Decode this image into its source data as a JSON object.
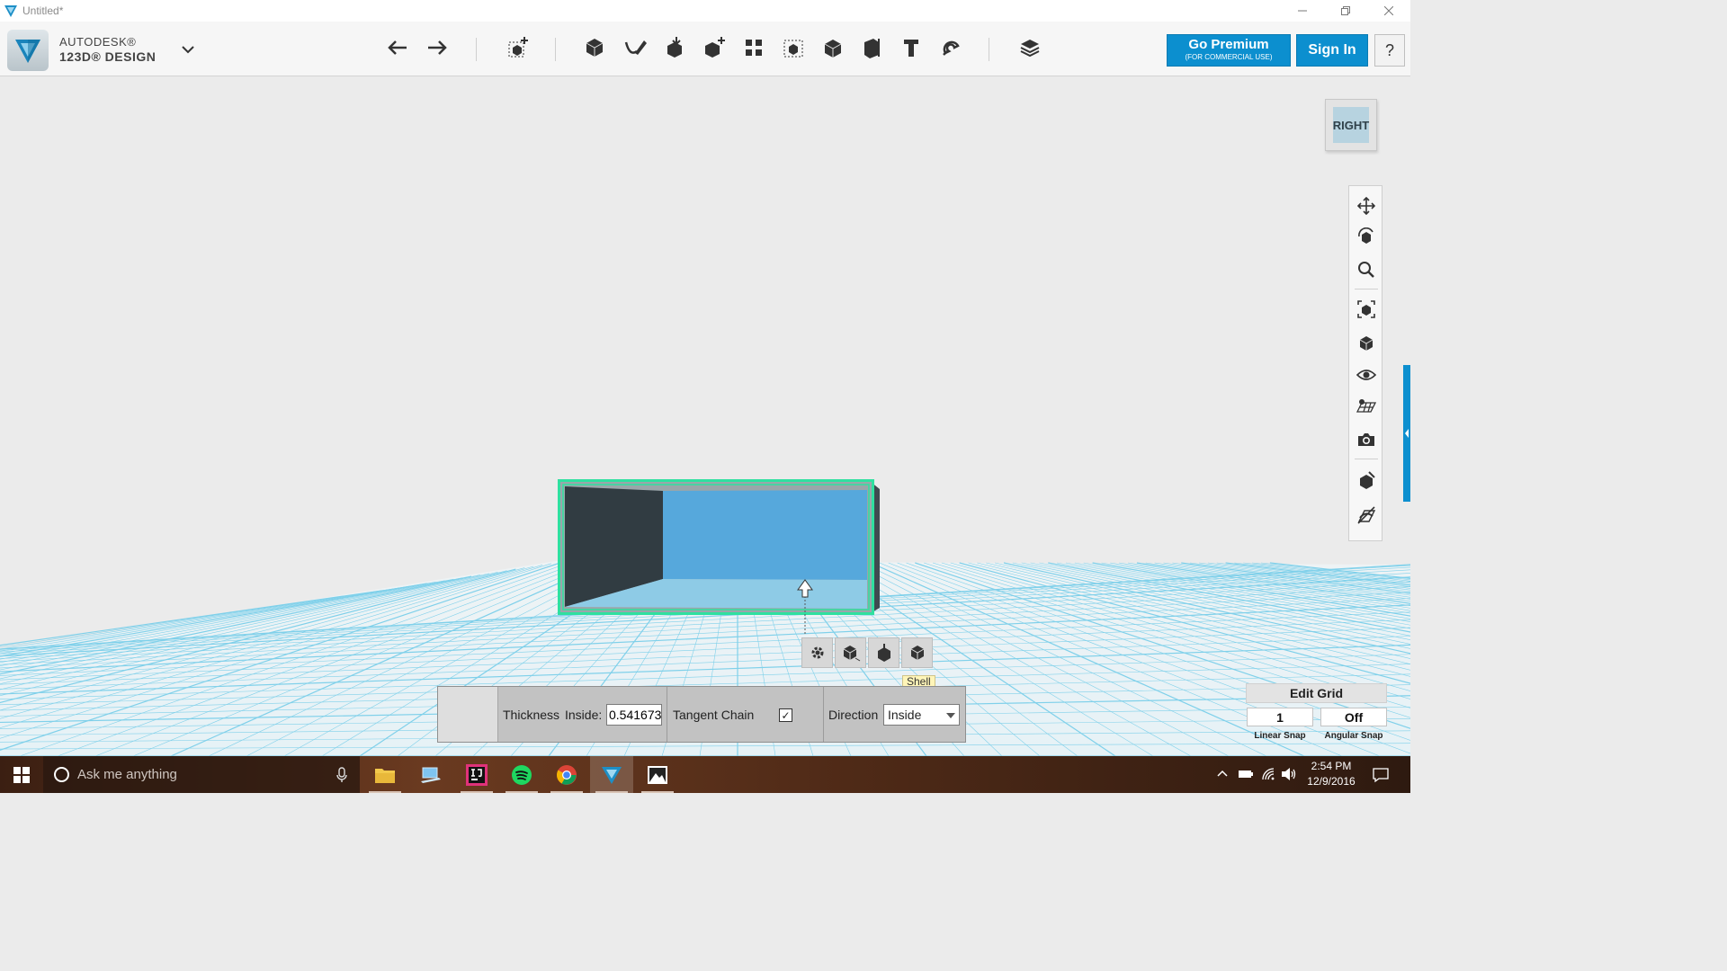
{
  "window": {
    "title": "Untitled*"
  },
  "brand": {
    "line1": "AUTODESK®",
    "line2": "123D® DESIGN"
  },
  "toolbar": {
    "tools": [
      "undo",
      "redo",
      "transform",
      "primitives",
      "sketch",
      "construct",
      "modify",
      "pattern",
      "grouping",
      "combine",
      "measure",
      "text",
      "snap",
      "materials"
    ],
    "premium_label": "Go Premium",
    "premium_sublabel": "(FOR COMMERCIAL USE)",
    "signin_label": "Sign In",
    "help_label": "?"
  },
  "viewcube": {
    "face_label": "RIGHT"
  },
  "navbar": {
    "items": [
      "pan",
      "orbit",
      "zoom",
      "fit",
      "views",
      "visibility",
      "grid-view",
      "screenshot",
      "material-edit",
      "hide-sketch"
    ]
  },
  "context_toolbar": {
    "tooltip": "Shell"
  },
  "shell_panel": {
    "thickness_label": "Thickness",
    "inside_label": "Inside:",
    "thickness_value": "0.541673",
    "tangent_chain_label": "Tangent Chain",
    "tangent_chain_checked": true,
    "direction_label": "Direction",
    "direction_value": "Inside"
  },
  "edit_grid": {
    "button_label": "Edit Grid",
    "linear_snap_value": "1",
    "angular_snap_value": "Off",
    "linear_snap_label": "Linear Snap",
    "angular_snap_label": "Angular Snap"
  },
  "taskbar": {
    "search_placeholder": "Ask me anything",
    "time": "2:54 PM",
    "date": "12/9/2016"
  },
  "colors": {
    "accent": "#0c8fcf",
    "selection": "#2fe0a0",
    "grid": "#7fd0ea",
    "inner_face": "#56a8dc"
  }
}
